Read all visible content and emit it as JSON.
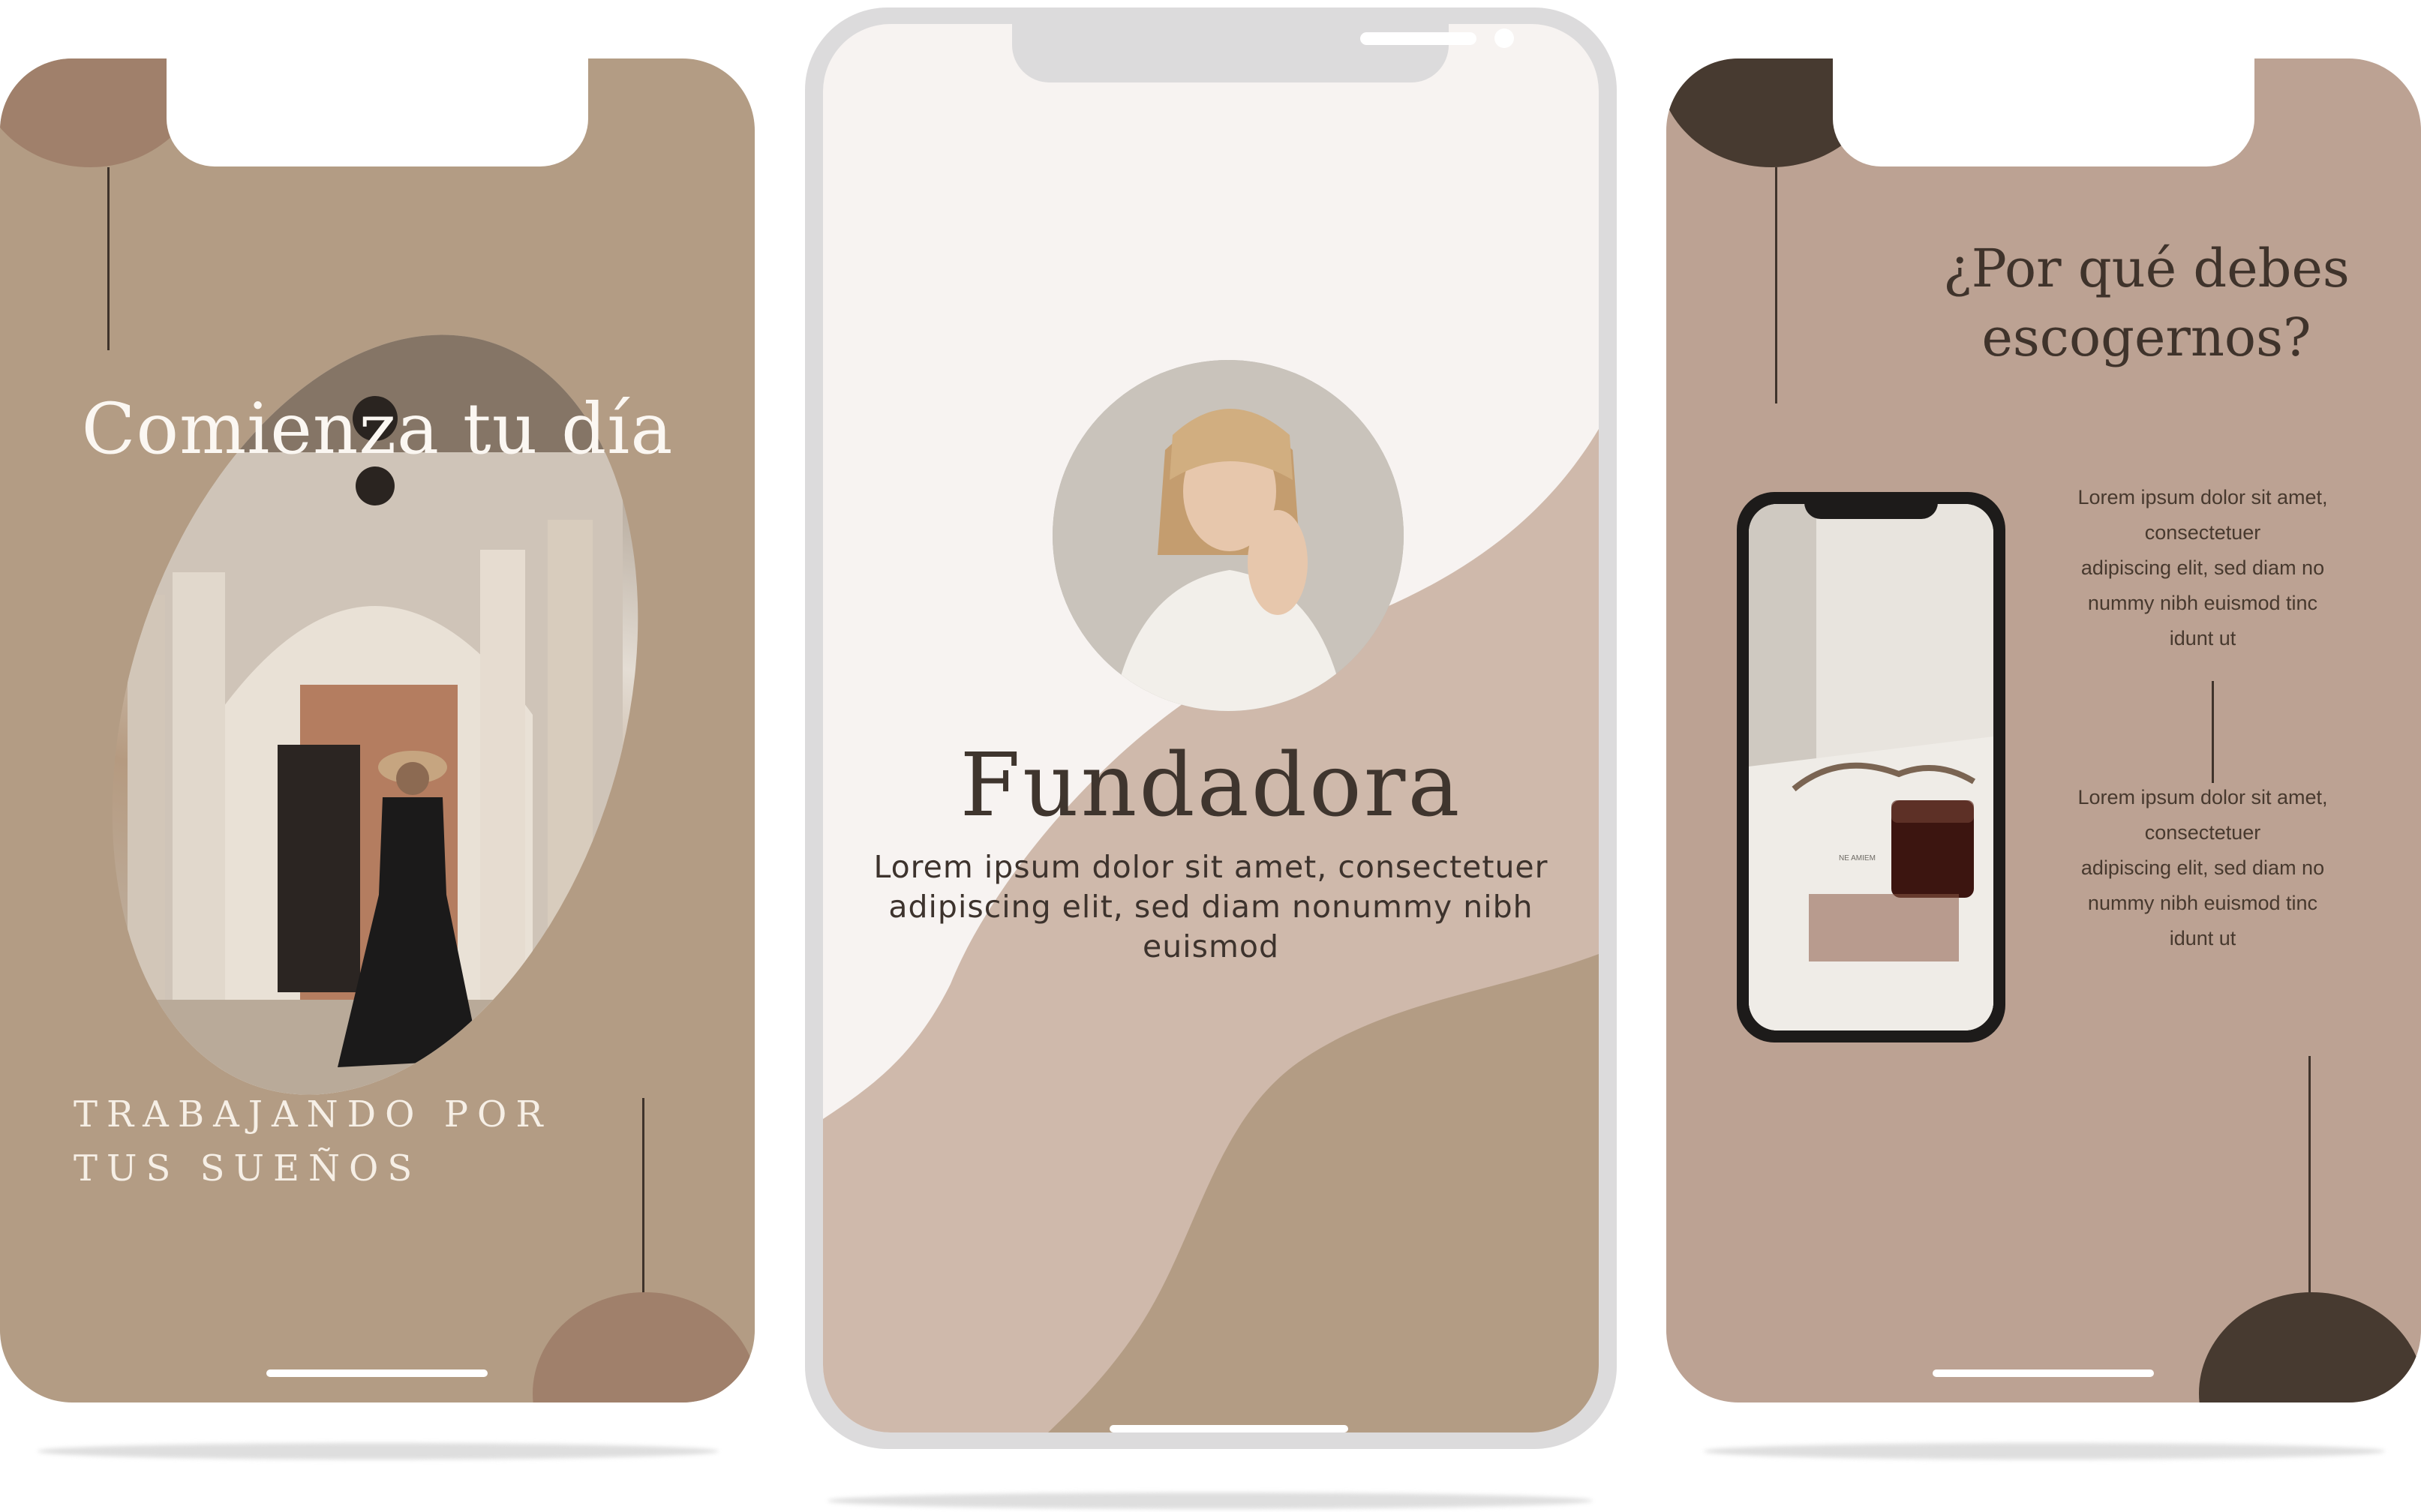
{
  "colors": {
    "left_background": "#b39c84",
    "left_accent": "#a0806b",
    "middle_frame": "#dcdbdc",
    "middle_background": "#f7f3f1",
    "middle_wave_light": "#cfb9ab",
    "middle_wave_dark": "#b39c84",
    "right_background": "#bca293",
    "right_accent": "#473a30",
    "dark_text": "#3f332b"
  },
  "left_story": {
    "title": "Comienza tu día",
    "subtitle_line1": "TRABAJANDO POR",
    "subtitle_line2": "TUS SUEÑOS"
  },
  "middle_story": {
    "heading": "Fundadora",
    "body": "Lorem ipsum dolor sit amet, consectetuer adipiscing elit, sed diam nonummy nibh euismod"
  },
  "right_story": {
    "heading_line1": "¿Por qué debes",
    "heading_line2": "escogernos?",
    "block1": [
      "Lorem ipsum dolor sit amet,",
      "consectetuer",
      "adipiscing elit, sed diam no",
      "nummy nibh euismod tinc",
      "idunt ut"
    ],
    "block2": [
      "Lorem ipsum dolor sit amet,",
      "consectetuer",
      "adipiscing elit, sed diam no",
      "nummy nibh euismod tinc",
      "idunt ut"
    ]
  }
}
